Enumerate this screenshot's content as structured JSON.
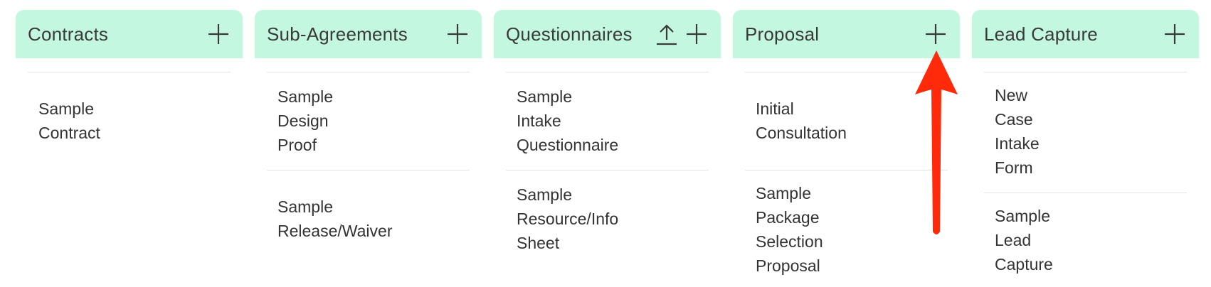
{
  "columns": [
    {
      "title": "Contracts",
      "items": [
        {
          "label": "Sample\nContract"
        }
      ]
    },
    {
      "title": "Sub-Agreements",
      "items": [
        {
          "label": "Sample\nDesign\nProof"
        },
        {
          "label": "Sample\nRelease/Waiver"
        }
      ]
    },
    {
      "title": "Questionnaires",
      "items": [
        {
          "label": "Sample\nIntake\nQuestionnaire"
        },
        {
          "label": "Sample\nResource/Info\nSheet"
        }
      ]
    },
    {
      "title": "Proposal",
      "items": [
        {
          "label": "Initial\nConsultation"
        },
        {
          "label": "Sample\nPackage\nSelection\nProposal"
        }
      ]
    },
    {
      "title": "Lead Capture",
      "items": [
        {
          "label": "New\nCase\nIntake\nForm"
        },
        {
          "label": "Sample\nLead\nCapture"
        }
      ]
    }
  ],
  "icons": {
    "add": "plus-icon",
    "upload": "upload-icon",
    "annotation": "red-arrow-pointing-up"
  },
  "colors": {
    "header_bg": "#c3f7df",
    "arrow": "#ff2a0a",
    "divider": "#e3e3e3"
  }
}
